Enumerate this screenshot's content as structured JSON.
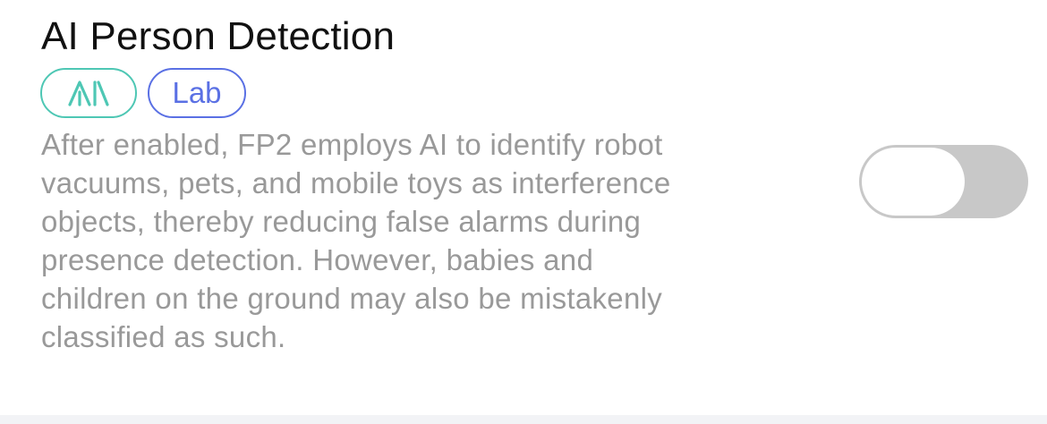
{
  "setting": {
    "title": "AI Person Detection",
    "badges": {
      "ai": {
        "icon": "ai-logo-icon",
        "color": "#4ec7b4"
      },
      "lab": {
        "label": "Lab",
        "color": "#5a70e4"
      }
    },
    "description": "After enabled, FP2 employs AI to identify robot\nvacuums, pets, and mobile toys as interference\nobjects, thereby reducing false alarms during\npresence detection. However, babies and\nchildren on the ground may also be mistakenly\nclassified as such.",
    "toggle": {
      "state": "off",
      "track_color": "#c8c8c8",
      "knob_color": "#ffffff"
    }
  }
}
